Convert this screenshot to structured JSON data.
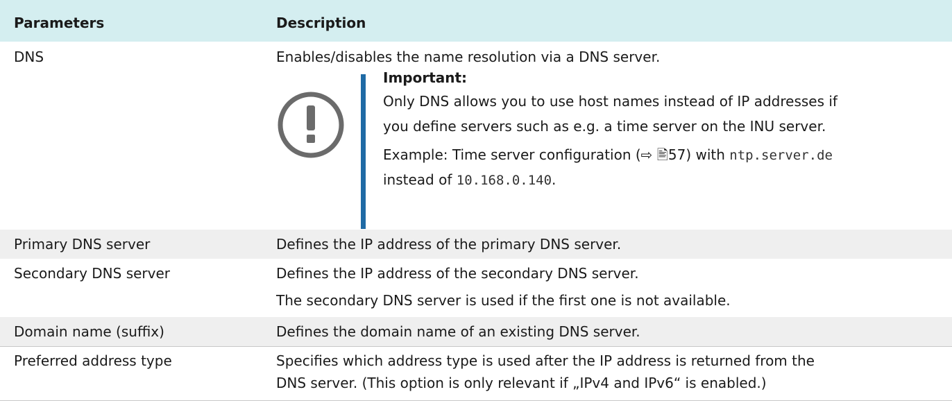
{
  "header": {
    "col1": "Parameters",
    "col2": "Description"
  },
  "dns": {
    "param": "DNS",
    "desc": "Enables/disables the name resolution via a DNS server.",
    "note_title": "Important:",
    "note_line1": "Only DNS allows you to use host names instead of IP addresses if",
    "note_line2": "you define servers such as e.g. a time server on the INU server.",
    "note_example_prefix": "Example: Time server configuration (",
    "note_example_ref": "⇨ 🖹57",
    "note_example_mid": ") with ",
    "note_example_host": "ntp.server.de",
    "note_example_instead": "instead of ",
    "note_example_ip": "10.168.0.140",
    "note_example_end": "."
  },
  "rows": [
    {
      "param": "Primary DNS server",
      "desc": "Defines the IP address of the primary DNS server."
    },
    {
      "param": "Secondary DNS server",
      "desc": "Defines the IP address of the secondary DNS server.",
      "desc2": "The secondary DNS server is used if the first one is not available."
    },
    {
      "param": "Domain name (suffix)",
      "desc": "Defines the domain name of an existing DNS server."
    },
    {
      "param": "Preferred address type",
      "desc": "Specifies which address type is used after the IP address is returned from the",
      "desc2": "DNS server. (This option is only relevant if „IPv4 and IPv6“ is enabled.)"
    }
  ],
  "colors": {
    "header_bg": "#d4eef0",
    "note_bar": "#1f6aa5",
    "shaded_row": "#efefef"
  },
  "icons": {
    "note": "exclamation-circle-icon"
  }
}
